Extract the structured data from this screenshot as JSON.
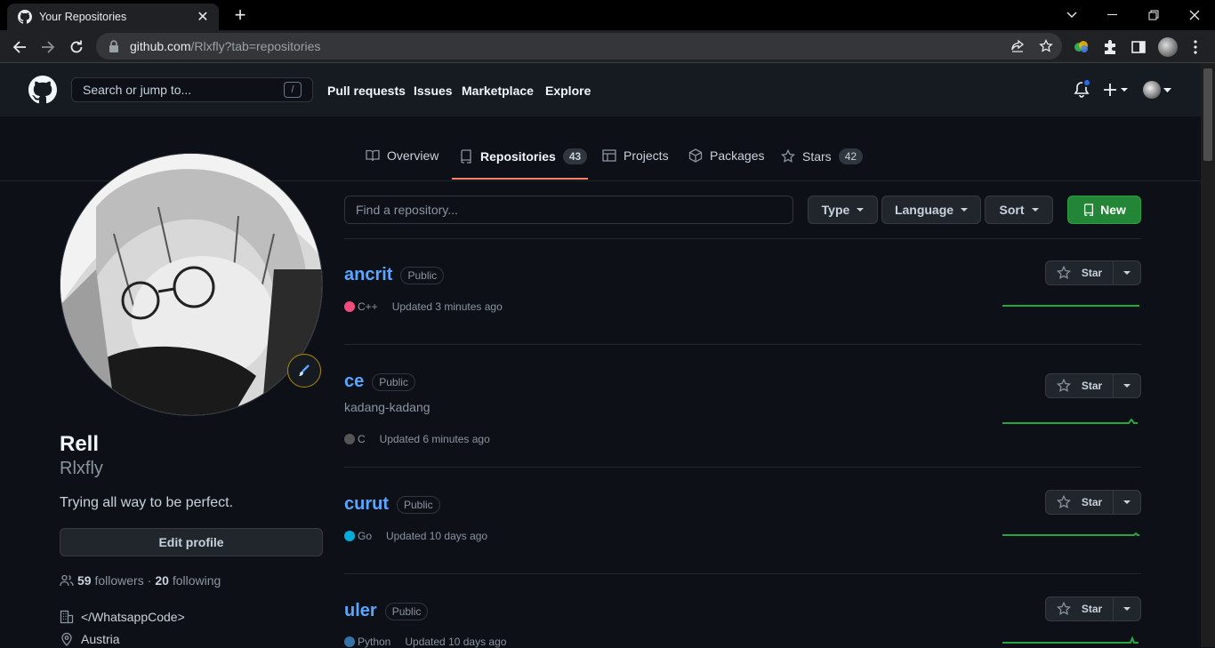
{
  "browser": {
    "tab_title": "Your Repositories",
    "url_host": "github.com",
    "url_path": "/Rlxfly?tab=repositories"
  },
  "header": {
    "search_placeholder": "Search or jump to...",
    "search_shortcut": "/",
    "nav": [
      "Pull requests",
      "Issues",
      "Marketplace",
      "Explore"
    ]
  },
  "profile_tabs": {
    "overview": "Overview",
    "repositories": "Repositories",
    "repositories_count": "43",
    "projects": "Projects",
    "packages": "Packages",
    "stars": "Stars",
    "stars_count": "42"
  },
  "profile": {
    "name": "Rell",
    "login": "Rlxfly",
    "bio": "Trying all way to be perfect.",
    "edit_label": "Edit profile",
    "followers_count": "59",
    "followers_label": "followers",
    "dot": "·",
    "following_count": "20",
    "following_label": "following",
    "company": "</WhatsappCode>",
    "location": "Austria"
  },
  "repo_controls": {
    "find_placeholder": "Find a repository...",
    "type": "Type",
    "language": "Language",
    "sort": "Sort",
    "new": "New"
  },
  "repos": [
    {
      "name": "ancrit",
      "visibility": "Public",
      "description": "",
      "language": "C++",
      "lang_color": "#f34b7d",
      "updated": "Updated 3 minutes ago",
      "star_label": "Star"
    },
    {
      "name": "ce",
      "visibility": "Public",
      "description": "kadang-kadang",
      "language": "C",
      "lang_color": "#555555",
      "updated": "Updated 6 minutes ago",
      "star_label": "Star"
    },
    {
      "name": "curut",
      "visibility": "Public",
      "description": "",
      "language": "Go",
      "lang_color": "#00ADD8",
      "updated": "Updated 10 days ago",
      "star_label": "Star"
    },
    {
      "name": "uler",
      "visibility": "Public",
      "description": "",
      "language": "Python",
      "lang_color": "#3572A5",
      "updated": "Updated 10 days ago",
      "star_label": "Star"
    }
  ],
  "colors": {
    "accent_link": "#58a6ff",
    "new_button": "#238636",
    "active_tab_underline": "#f78166",
    "sparkline": "#26a641"
  }
}
